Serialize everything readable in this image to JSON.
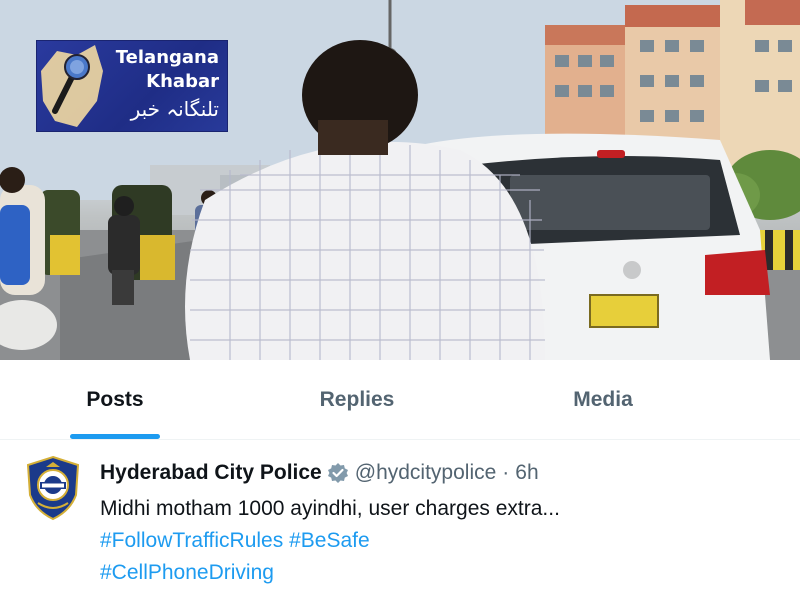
{
  "banner": {
    "logo": {
      "line1": "Telangana",
      "line2": "Khabar",
      "urdu": "تلنگانہ خبر"
    }
  },
  "tabs": [
    {
      "label": "Posts",
      "active": true
    },
    {
      "label": "Replies",
      "active": false
    },
    {
      "label": "Media",
      "active": false
    }
  ],
  "post": {
    "author": "Hyderabad City Police",
    "verified": true,
    "handle": "@hydcitypolice",
    "separator": "·",
    "time": "6h",
    "text": "Midhi motham 1000 ayindhi, user charges extra...",
    "hashtags_line1": [
      "#FollowTrafficRules",
      "#BeSafe"
    ],
    "hashtags_line2": [
      "#CellPhoneDriving"
    ]
  },
  "colors": {
    "accent": "#1d9bf0",
    "text_primary": "#0f1419",
    "text_secondary": "#536471",
    "logo_bg": "#2a3a9e"
  }
}
